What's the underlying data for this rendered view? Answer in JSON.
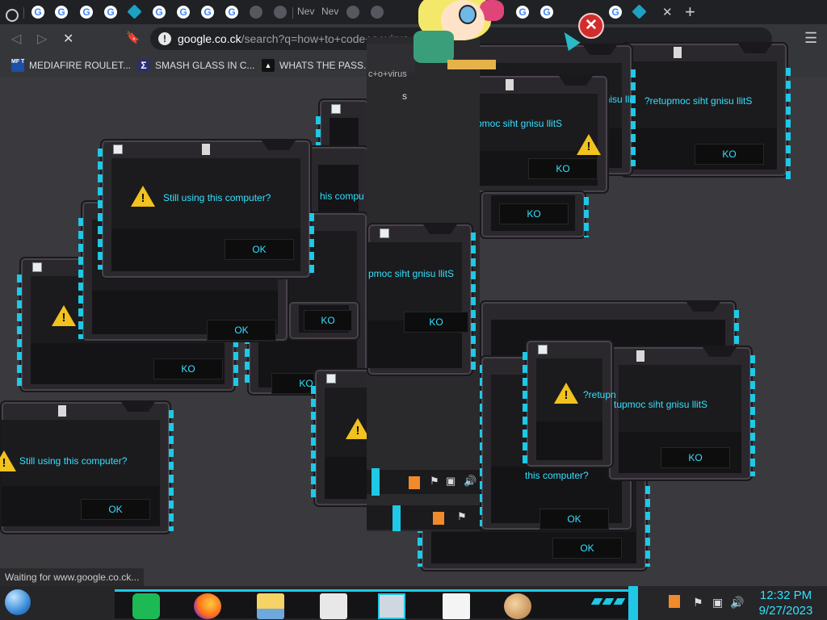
{
  "browser": {
    "tabs": [
      {
        "favicon": "history-icon"
      },
      {
        "favicon": "google-icon",
        "letter": "G"
      },
      {
        "favicon": "google-icon",
        "letter": "G"
      },
      {
        "favicon": "google-icon",
        "letter": "G"
      },
      {
        "favicon": "google-icon",
        "letter": "G"
      },
      {
        "favicon": "teal-diamond-icon"
      },
      {
        "favicon": "google-icon",
        "letter": "G"
      },
      {
        "favicon": "google-icon",
        "letter": "G"
      },
      {
        "favicon": "google-icon",
        "letter": "G"
      },
      {
        "favicon": "google-icon",
        "letter": "G"
      },
      {
        "favicon": "loading-globe-icon"
      },
      {
        "favicon": "loading-globe-icon"
      },
      {
        "title": "Nev"
      },
      {
        "title": "Nev"
      },
      {
        "favicon": "loading-globe-icon"
      },
      {
        "favicon": "loading-globe-icon"
      }
    ],
    "right_tabs": [
      {
        "favicon": "google-icon",
        "letter": "G"
      },
      {
        "favicon": "google-icon",
        "letter": "G"
      },
      {
        "favicon": "google-icon",
        "letter": "G"
      },
      {
        "favicon": "google-icon",
        "letter": "G"
      },
      {
        "favicon": "teal-diamond-icon"
      }
    ],
    "close_glyph": "✕",
    "new_tab_glyph": "+",
    "back_glyph": "◁",
    "forward_glyph": "▷",
    "stop_glyph": "✕",
    "bookmark_glyph": "🔖",
    "menu_glyph": "☰",
    "info_glyph": "!",
    "url_domain": "google.co.ck",
    "url_path": "/search?q=how+to+code+a+virus",
    "bookmarks": [
      {
        "icon": "mediafire-icon",
        "icon_text": "MF T",
        "label": "MEDIAFIRE ROULET..."
      },
      {
        "icon": "smash-glass-icon",
        "icon_text": "Σ",
        "label": "SMASH GLASS IN C..."
      },
      {
        "icon": "password-icon",
        "icon_text": "▲",
        "label": "WHATS THE PASS..."
      }
    ],
    "status_text": "Waiting for www.google.co.ck..."
  },
  "popups": {
    "normal_msg": "Still using this computer?",
    "mirrored_msg": "?retupmoc siht gnisu llitS",
    "ok_label": "OK",
    "ko_label": "KO",
    "partial_a": "this computer?",
    "partial_b": "his compu",
    "partial_c": "?retupmoc siht gnisu llit",
    "partial_d": "?retupn",
    "partial_e": "tupmoc siht gnisu llitS",
    "partial_f": "c+o+virus",
    "partial_g": "pmoc siht gnisu llitS",
    "partial_h": "s"
  },
  "taskbar": {
    "clock_time": "12:32 PM",
    "clock_date": "9/27/2023",
    "apps": [
      "spotify-icon",
      "firefox-icon",
      "file-explorer-icon",
      "calculator-icon",
      "news-icon",
      "wordpad-icon",
      "paint-icon"
    ],
    "tray": {
      "java": "java-icon",
      "flag": "⚑",
      "network": "▣",
      "volume": "🔊"
    }
  },
  "colors": {
    "accent": "#1ec8e6",
    "text_cyan": "#33e0ff",
    "warning": "#f2c21e",
    "error": "#d22c2c"
  }
}
